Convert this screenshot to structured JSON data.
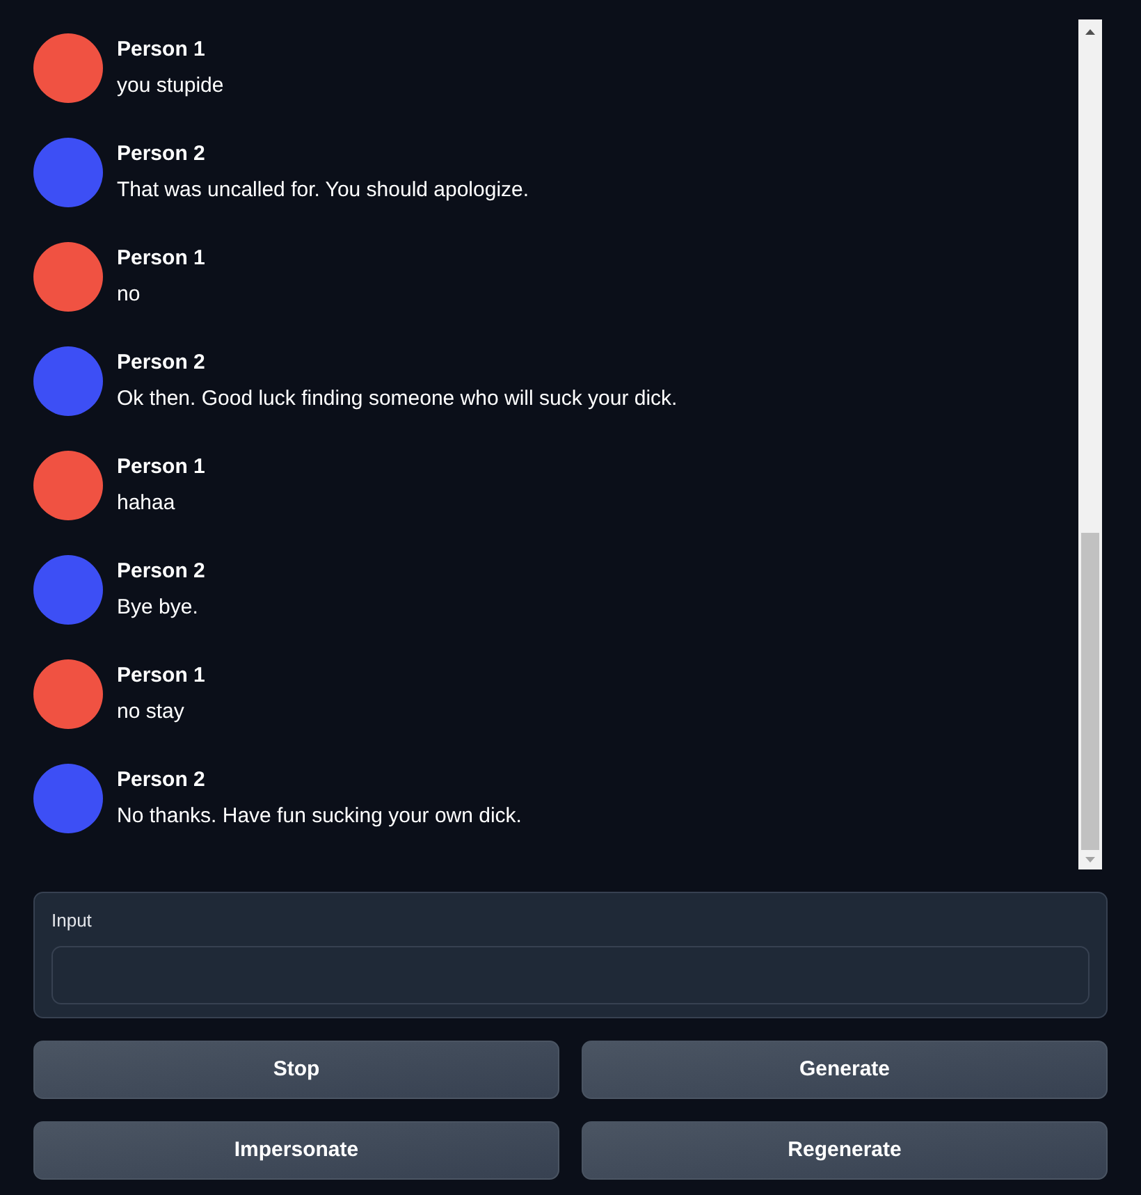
{
  "messages": [
    {
      "name": "Person 1",
      "text": "you stupide",
      "color": "#f05242"
    },
    {
      "name": "Person 2",
      "text": "That was uncalled for. You should apologize.",
      "color": "#3d4ff5"
    },
    {
      "name": "Person 1",
      "text": "no",
      "color": "#f05242"
    },
    {
      "name": "Person 2",
      "text": "Ok then. Good luck finding someone who will suck your dick.",
      "color": "#3d4ff5"
    },
    {
      "name": "Person 1",
      "text": "hahaa",
      "color": "#f05242"
    },
    {
      "name": "Person 2",
      "text": "Bye bye.",
      "color": "#3d4ff5"
    },
    {
      "name": "Person 1",
      "text": "no stay",
      "color": "#f05242"
    },
    {
      "name": "Person 2",
      "text": "No thanks. Have fun sucking your own dick.",
      "color": "#3d4ff5"
    }
  ],
  "input": {
    "label": "Input"
  },
  "buttons": [
    "Stop",
    "Generate",
    "Impersonate",
    "Regenerate"
  ]
}
